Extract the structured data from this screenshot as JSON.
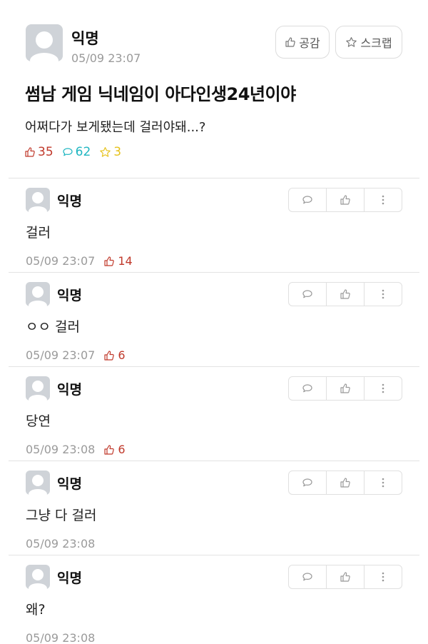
{
  "post": {
    "author": "익명",
    "time": "05/09 23:07",
    "like_button": "공감",
    "scrap_button": "스크랩",
    "title": "썸남 게임 닉네임이 아다인생24년이야",
    "body": "어쩌다가 보게됐는데 걸러야돼...?",
    "likes": "35",
    "comments": "62",
    "scraps": "3"
  },
  "colors": {
    "like": "#c0392b",
    "comment": "#1fb6c1",
    "scrap": "#e6c21b",
    "meta": "#9a9a9a"
  },
  "comments": [
    {
      "author": "익명",
      "text": "걸러",
      "time": "05/09 23:07",
      "likes": "14"
    },
    {
      "author": "익명",
      "text": "ㅇㅇ 걸러",
      "time": "05/09 23:07",
      "likes": "6"
    },
    {
      "author": "익명",
      "text": "당연",
      "time": "05/09 23:08",
      "likes": "6"
    },
    {
      "author": "익명",
      "text": "그냥 다 걸러",
      "time": "05/09 23:08",
      "likes": ""
    },
    {
      "author": "익명",
      "text": "왜?",
      "time": "05/09 23:08",
      "likes": ""
    }
  ],
  "icons": {
    "like": "thumbs-up-icon",
    "comment": "speech-bubble-icon",
    "scrap": "star-icon",
    "more": "more-vertical-icon"
  }
}
